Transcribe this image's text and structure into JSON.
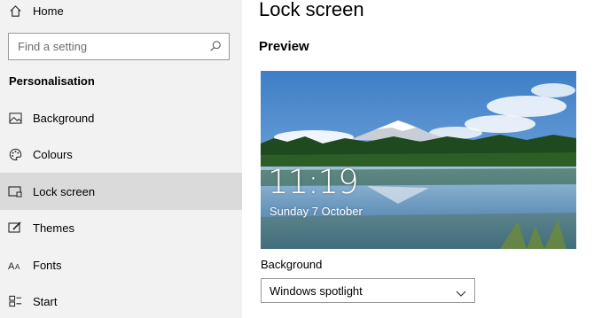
{
  "nav": {
    "home_label": "Home",
    "section_title": "Personalisation",
    "items": [
      {
        "label": "Background",
        "icon": "image-icon"
      },
      {
        "label": "Colours",
        "icon": "palette-icon"
      },
      {
        "label": "Lock screen",
        "icon": "lock-screen-icon",
        "selected": true
      },
      {
        "label": "Themes",
        "icon": "themes-icon"
      },
      {
        "label": "Fonts",
        "icon": "fonts-icon"
      },
      {
        "label": "Start",
        "icon": "start-icon"
      }
    ]
  },
  "search": {
    "placeholder": "Find a setting"
  },
  "main": {
    "title": "Lock screen",
    "preview_heading": "Preview",
    "preview": {
      "time": "11:19",
      "date": "Sunday 7 October"
    },
    "background_label": "Background",
    "background_value": "Windows spotlight"
  },
  "colors": {
    "sidebar_bg": "#f2f2f2",
    "selected_bg": "#dadada"
  }
}
